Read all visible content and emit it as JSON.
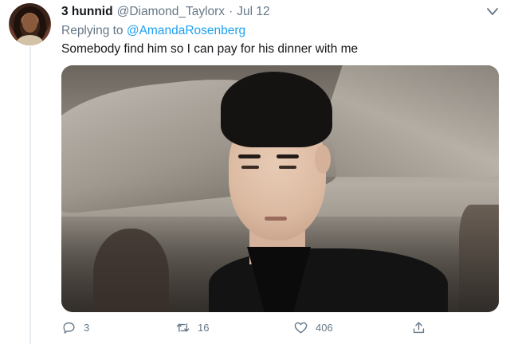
{
  "tweet": {
    "display_name": "3 hunnid",
    "handle": "@Diamond_Taylorx",
    "separator": "·",
    "date": "Jul 12",
    "replying_prefix": "Replying to",
    "replying_to": "@AmandaRosenberg",
    "text": "Somebody find him so I can pay for his dinner with me",
    "media": {
      "kind": "image",
      "subject": "man-in-black-suit-photo"
    },
    "actions": {
      "reply_count": "3",
      "retweet_count": "16",
      "like_count": "406"
    },
    "icons": {
      "menu": "chevron-down-icon",
      "reply": "reply-icon",
      "retweet": "retweet-icon",
      "like": "heart-icon",
      "share": "share-icon"
    }
  },
  "colors": {
    "link": "#1da1f2",
    "secondary_text": "#657786",
    "primary_text": "#14171a",
    "thread_line": "#e6ecf0"
  }
}
